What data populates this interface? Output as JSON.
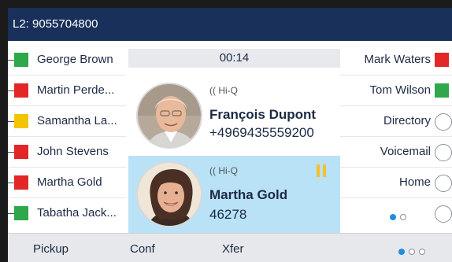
{
  "header": {
    "line_label": "L2: 9055704800"
  },
  "left_keys": [
    {
      "label": "George Brown",
      "status": "available",
      "color": "#2ea84a"
    },
    {
      "label": "Martin Perde...",
      "status": "busy",
      "color": "#e32626"
    },
    {
      "label": "Samantha La...",
      "status": "away",
      "color": "#f2c500"
    },
    {
      "label": "John Stevens",
      "status": "busy",
      "color": "#e32626"
    },
    {
      "label": "Martha Gold",
      "status": "busy",
      "color": "#e32626"
    },
    {
      "label": "Tabatha Jack...",
      "status": "available",
      "color": "#2ea84a"
    }
  ],
  "right_keys": [
    {
      "label": "Mark Waters",
      "color": "#e32626"
    },
    {
      "label": "Tom Wilson",
      "color": "#2ea84a"
    },
    {
      "label": "Directory"
    },
    {
      "label": "Voicemail"
    },
    {
      "label": "Home"
    }
  ],
  "call_timer": "00:14",
  "calls": [
    {
      "codec": "Hi-Q",
      "name": "François Dupont",
      "number": "+4969435559200",
      "state": "active"
    },
    {
      "codec": "Hi-Q",
      "name": "Martha Gold",
      "number": "46278",
      "state": "hold"
    }
  ],
  "softkeys": [
    {
      "label": "Pickup"
    },
    {
      "label": "Conf"
    },
    {
      "label": "Xfer"
    }
  ],
  "colors": {
    "header": "#18305a",
    "hold_highlight": "#b9e2f6",
    "pager_active": "#1f8de0"
  }
}
